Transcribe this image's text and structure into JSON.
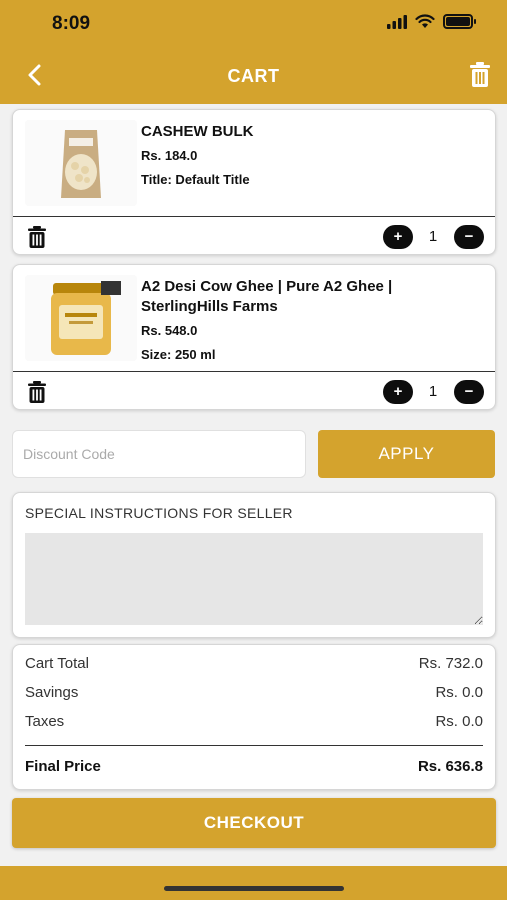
{
  "status_bar": {
    "time": "8:09"
  },
  "header": {
    "title": "CART"
  },
  "cart_items": [
    {
      "name": "CASHEW BULK",
      "price": "Rs. 184.0",
      "variant": "Title: Default Title",
      "quantity": "1",
      "plus": "+",
      "minus": "−"
    },
    {
      "name": "A2 Desi Cow Ghee | Pure A2 Ghee | SterlingHills Farms",
      "price": "Rs. 548.0",
      "variant": "Size: 250 ml",
      "quantity": "1",
      "plus": "+",
      "minus": "−"
    }
  ],
  "discount": {
    "placeholder": "Discount Code",
    "apply_label": "APPLY"
  },
  "instructions": {
    "label": "SPECIAL INSTRUCTIONS FOR SELLER"
  },
  "summary": {
    "cart_total_label": "Cart Total",
    "cart_total_value": "Rs. 732.0",
    "savings_label": "Savings",
    "savings_value": "Rs. 0.0",
    "taxes_label": "Taxes",
    "taxes_value": "Rs. 0.0",
    "final_label": "Final Price",
    "final_value": "Rs. 636.8"
  },
  "checkout_label": "CHECKOUT",
  "colors": {
    "accent": "#d4a32d",
    "button_dark": "#0d0d0d",
    "instructions_bg": "#e6e6e6"
  }
}
